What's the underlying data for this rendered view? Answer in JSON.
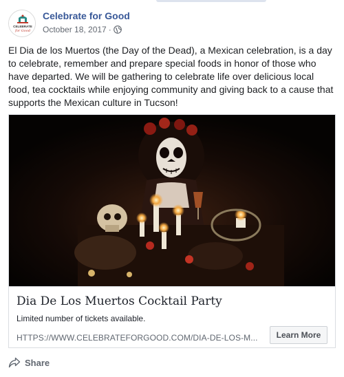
{
  "page": {
    "name": "Celebrate for Good",
    "date": "October 18, 2017",
    "separator": "·",
    "avatar_text_top": "CELEBRATE",
    "avatar_text_bottom": "for Good"
  },
  "post": {
    "text": "El Dia de los Muertos (the Day of the Dead), a Mexican celebration, is a day to celebrate, remember and prepare special foods in honor of those who have departed. We will be gathering to celebrate life over delicious local food, tea cocktails while enjoying community and giving back to a cause that supports the Mexican culture in Tucson!"
  },
  "card": {
    "title": "Dia De Los Muertos Cocktail Party",
    "description": "Limited number of tickets available.",
    "url": "HTTPS://WWW.CELEBRATEFORGOOD.COM/DIA-DE-LOS-M...",
    "button_label": "Learn More"
  },
  "footer": {
    "share_label": "Share"
  },
  "colors": {
    "brand_link": "#385898",
    "avatar_accent": "#2a8c87",
    "avatar_accent2": "#c0392b"
  },
  "icons": [
    "globe-icon",
    "share-icon"
  ]
}
